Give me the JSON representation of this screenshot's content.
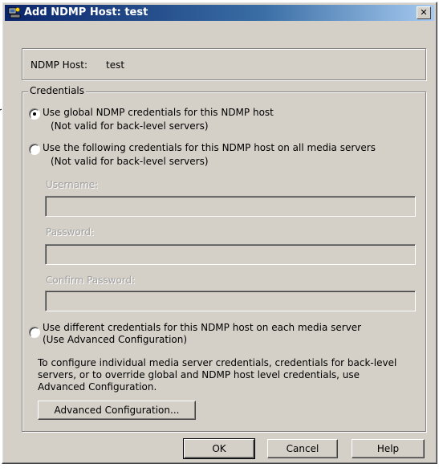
{
  "window": {
    "title": "Add NDMP Host: test",
    "close_label": "✕"
  },
  "host": {
    "label": "NDMP Host:",
    "value": "test"
  },
  "credentials": {
    "legend": "Credentials",
    "options": [
      {
        "line1": "Use global NDMP credentials for this NDMP host",
        "line2": "(Not valid for back-level servers)",
        "selected": true
      },
      {
        "line1": "Use the following credentials for this NDMP host on all media servers",
        "line2": "(Not valid for back-level servers)",
        "selected": false
      },
      {
        "line1": "Use different credentials for this NDMP host on each media server",
        "line2": "(Use Advanced Configuration)",
        "selected": false
      }
    ],
    "fields": {
      "username_label": "Username:",
      "username_value": "",
      "password_label": "Password:",
      "password_value": "",
      "confirm_label": "Confirm Password:",
      "confirm_value": ""
    },
    "advanced_note": [
      "To configure individual media server credentials, credentials for back-level",
      "servers, or to override global and NDMP host level credentials, use",
      "Advanced Configuration."
    ],
    "advanced_button": "Advanced Configuration..."
  },
  "buttons": {
    "ok": "OK",
    "cancel": "Cancel",
    "help": "Help"
  },
  "colors": {
    "dialog_bg": "#d4d0c8",
    "titlebar_start": "#0a246a",
    "titlebar_end": "#a6caf0",
    "disabled_text": "#a0a0a0"
  }
}
